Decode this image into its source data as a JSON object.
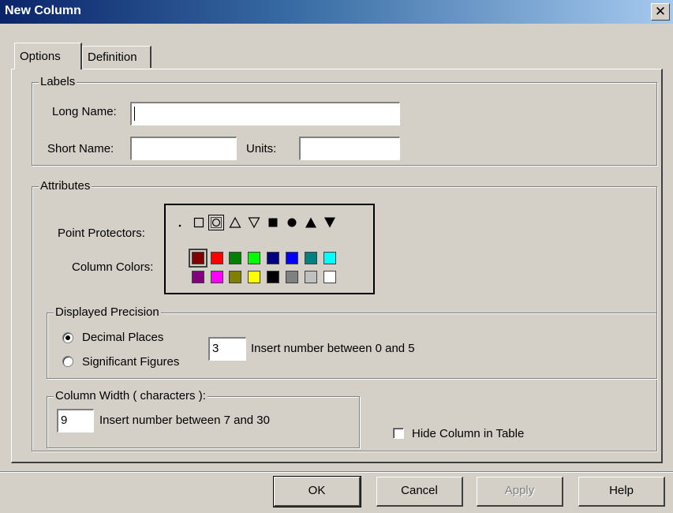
{
  "window": {
    "title": "New Column",
    "close_symbol": "✕"
  },
  "tabs": [
    {
      "label": "Options",
      "active": true
    },
    {
      "label": "Definition",
      "active": false
    }
  ],
  "labels_group": {
    "title": "Labels",
    "long_name_label": "Long Name:",
    "long_name_value": "",
    "short_name_label": "Short Name:",
    "short_name_value": "",
    "units_label": "Units:",
    "units_value": ""
  },
  "attributes_group": {
    "title": "Attributes",
    "point_protectors_label": "Point Protectors:",
    "column_colors_label": "Column Colors:",
    "point_symbols": [
      "dot-icon",
      "open-square-icon",
      "open-circle-icon",
      "open-triangle-up-icon",
      "open-triangle-down-icon",
      "filled-square-icon",
      "filled-circle-icon",
      "filled-triangle-up-icon",
      "filled-triangle-down-icon"
    ],
    "selected_symbol": "open-circle-icon",
    "colors_row1": [
      "#800000",
      "#ff0000",
      "#008000",
      "#00ff00",
      "#000080",
      "#0000ff",
      "#008080",
      "#00ffff"
    ],
    "colors_row2": [
      "#800080",
      "#ff00ff",
      "#808000",
      "#ffff00",
      "#000000",
      "#808080",
      "#c0c0c0",
      "#ffffff"
    ],
    "selected_color": "#800000"
  },
  "precision_group": {
    "title": "Displayed Precision",
    "option_decimal": "Decimal Places",
    "option_significant": "Significant Figures",
    "selected": "Decimal Places",
    "value": "3",
    "hint": "Insert number between 0 and 5"
  },
  "width_group": {
    "title": "Column Width ( characters ):",
    "value": "9",
    "hint": "Insert number between 7 and 30"
  },
  "hide_column": {
    "label": "Hide Column in Table",
    "checked": false
  },
  "buttons": {
    "ok": "OK",
    "cancel": "Cancel",
    "apply": "Apply",
    "help": "Help"
  }
}
